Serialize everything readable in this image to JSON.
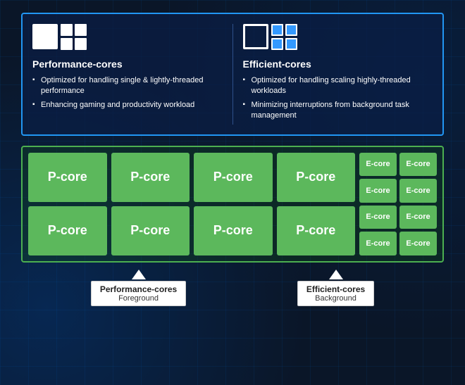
{
  "page": {
    "background_color": "#0a1628",
    "accent_color": "#2196f3",
    "green_color": "#5cb85c"
  },
  "top": {
    "border_color": "#2196f3",
    "p_core_box": {
      "title": "Performance-cores",
      "bullets": [
        "Optimized for handling single & lightly-threaded performance",
        "Enhancing gaming and productivity workload"
      ]
    },
    "e_core_box": {
      "title": "Efficient-cores",
      "bullets": [
        "Optimized for handling scaling highly-threaded workloads",
        "Minimizing interruptions from background task management"
      ]
    }
  },
  "core_grid": {
    "p_cores": [
      "P-core",
      "P-core",
      "P-core",
      "P-core",
      "P-core",
      "P-core",
      "P-core",
      "P-core"
    ],
    "e_cores": [
      "E-core",
      "E-core",
      "E-core",
      "E-core",
      "E-core",
      "E-core",
      "E-core",
      "E-core"
    ]
  },
  "labels": {
    "left": {
      "main": "Performance-cores",
      "sub": "Foreground"
    },
    "right": {
      "main": "Efficient-cores",
      "sub": "Background"
    }
  }
}
